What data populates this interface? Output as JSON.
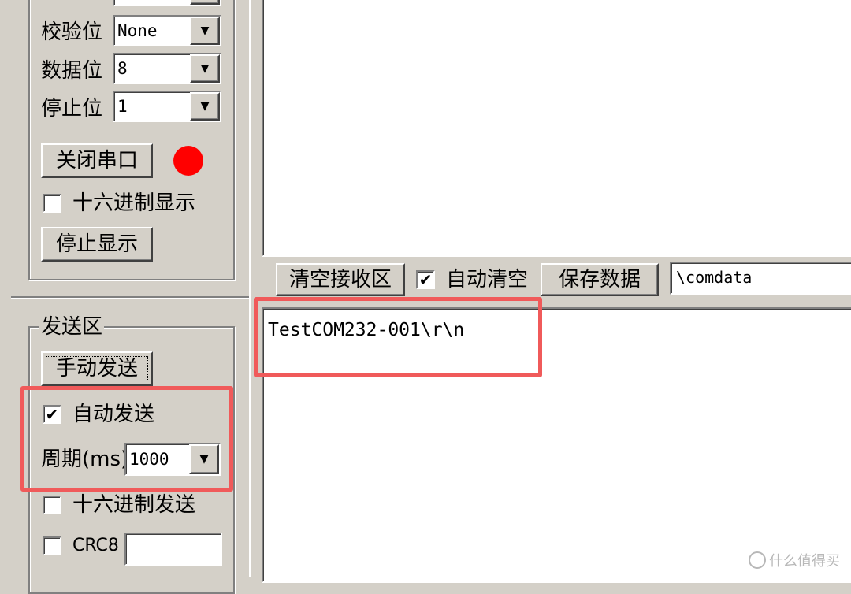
{
  "serial": {
    "parity_label": "校验位",
    "parity_value": "None",
    "databits_label": "数据位",
    "databits_value": "8",
    "stopbits_label": "停止位",
    "stopbits_value": "1",
    "close_port_button": "关闭串口",
    "port_status_color": "#ff0000",
    "hex_display_label": "十六进制显示",
    "hex_display_checked": false,
    "stop_display_button": "停止显示"
  },
  "receive_toolbar": {
    "clear_button": "清空接收区",
    "auto_clear_label": "自动清空",
    "auto_clear_checked": true,
    "save_button": "保存数据",
    "path_value": "\\comdata"
  },
  "send": {
    "group_title": "发送区",
    "manual_send_button": "手动发送",
    "auto_send_label": "自动发送",
    "auto_send_checked": true,
    "period_label": "周期(ms)",
    "period_value": "1000",
    "hex_send_label": "十六进制发送",
    "hex_send_checked": false,
    "crc_label": "CRC8",
    "crc_checked": false,
    "crc_value": ""
  },
  "send_text": "TestCOM232-001\\r\\n",
  "watermark": "什么值得买",
  "highlight_color": "#f05a5a"
}
